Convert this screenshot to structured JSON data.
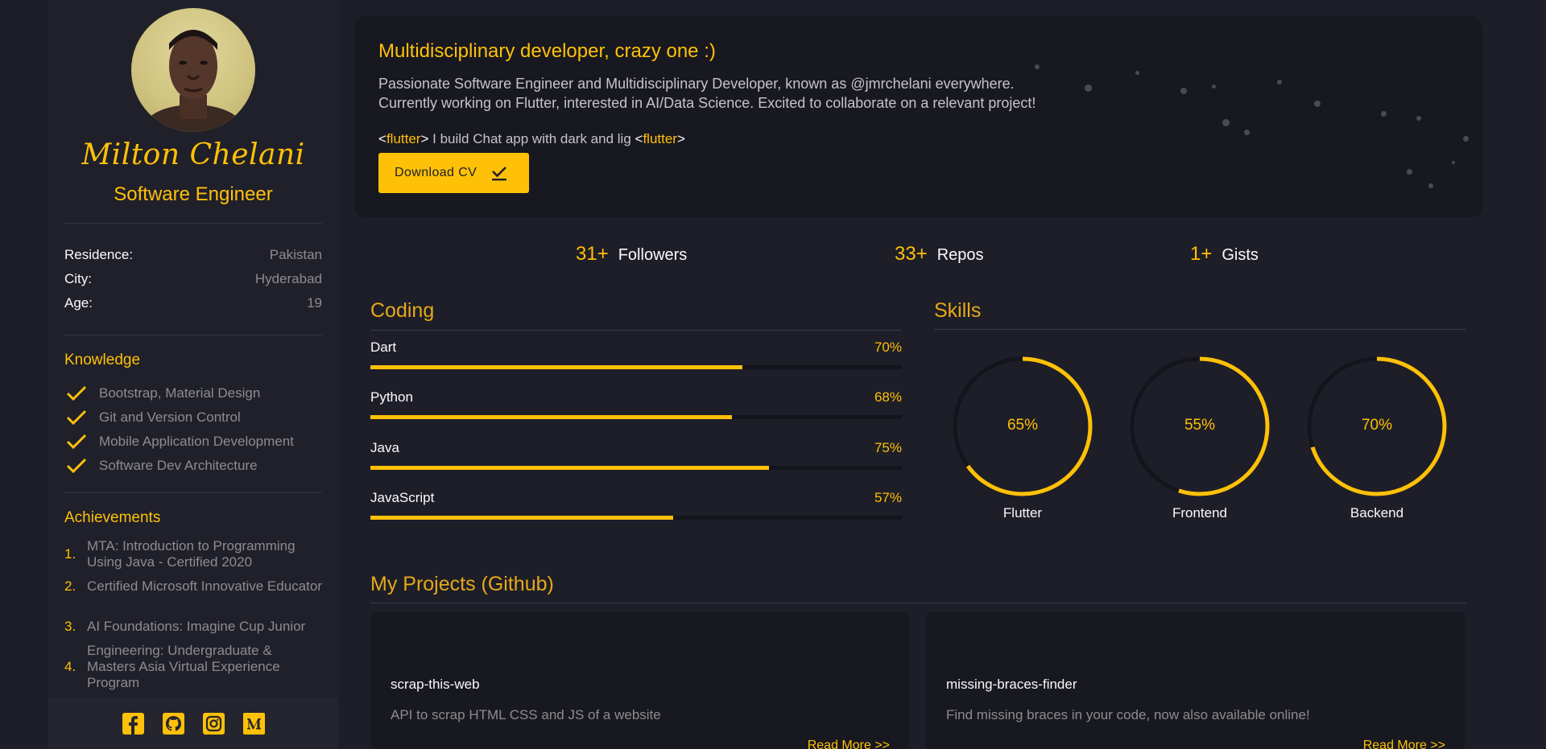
{
  "profile": {
    "name": "Milton Chelani",
    "role": "Software Engineer",
    "info": [
      {
        "label": "Residence:",
        "value": "Pakistan"
      },
      {
        "label": "City:",
        "value": "Hyderabad"
      },
      {
        "label": "Age:",
        "value": "19"
      }
    ]
  },
  "knowledge": {
    "title": "Knowledge",
    "items": [
      "Bootstrap, Material Design",
      "Git and Version Control",
      "Mobile Application Development",
      "Software Dev Architecture"
    ]
  },
  "achievements": {
    "title": "Achievements",
    "items": [
      {
        "num": "1.",
        "text": "MTA: Introduction to Programming Using Java - Certified 2020"
      },
      {
        "num": "2.",
        "text": "Certified Microsoft Innovative Educator"
      },
      {
        "num": "3.",
        "text": "AI Foundations: Imagine Cup Junior"
      },
      {
        "num": "4.",
        "text": "Engineering: Undergraduate & Masters Asia Virtual Experience Program"
      }
    ]
  },
  "socials": [
    "facebook-icon",
    "github-icon",
    "instagram-icon",
    "medium-icon"
  ],
  "hero": {
    "title": "Multidisciplinary developer, crazy one :)",
    "desc_line1": "Passionate Software Engineer and Multidisciplinary Developer, known as @jmrchelani everywhere.",
    "desc_line2": "Currently working on Flutter, interested in AI/Data Science. Excited to collaborate on a relevant project!",
    "code_open": "<",
    "code_tag": "flutter",
    "code_close": ">",
    "code_text": " I build Chat app with dark and lig ",
    "button_label": "Download CV"
  },
  "stats": [
    {
      "value": "31+",
      "label": "Followers"
    },
    {
      "value": "33+",
      "label": "Repos"
    },
    {
      "value": "1+",
      "label": "Gists"
    }
  ],
  "coding": {
    "title": "Coding",
    "items": [
      {
        "label": "Dart",
        "value": "70%",
        "level": 0.7
      },
      {
        "label": "Python",
        "value": "68%",
        "level": 0.68
      },
      {
        "label": "Java",
        "value": "75%",
        "level": 0.75
      },
      {
        "label": "JavaScript",
        "value": "57%",
        "level": 0.57
      }
    ]
  },
  "skills": {
    "title": "Skills",
    "items": [
      {
        "label": "Flutter",
        "value": "65%",
        "level": 0.65
      },
      {
        "label": "Frontend",
        "value": "55%",
        "level": 0.55
      },
      {
        "label": "Backend",
        "value": "70%",
        "level": 0.7
      }
    ]
  },
  "projects": {
    "title": "My Projects (Github)",
    "items": [
      {
        "name": "scrap-this-web",
        "desc": "API to scrap HTML CSS and JS of a website",
        "link": "Read More >>"
      },
      {
        "name": "missing-braces-finder",
        "desc": "Find missing braces in your code, now also available online!",
        "link": "Read More >>"
      }
    ]
  },
  "colors": {
    "accent": "#ffc107",
    "background": "#1e1e28",
    "card": "#181820",
    "sidebar": "#20202a"
  }
}
